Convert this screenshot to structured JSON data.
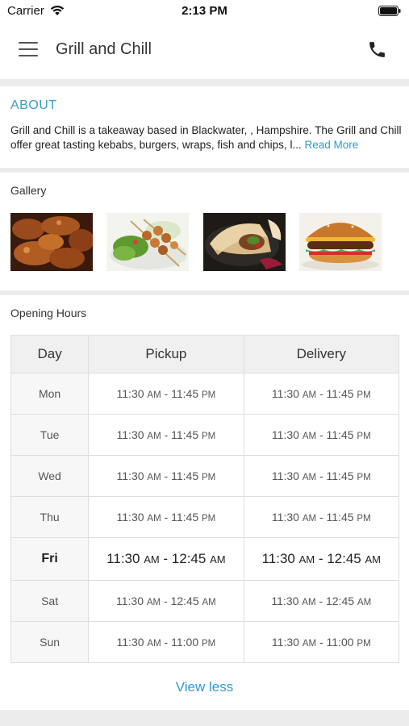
{
  "status_bar": {
    "carrier": "Carrier",
    "time": "2:13 PM"
  },
  "header": {
    "title": "Grill and Chill"
  },
  "about": {
    "heading": "ABOUT",
    "text": "Grill and Chill is a takeaway based in Blackwater,  , Hampshire. The Grill and Chill offer great tasting kebabs, burgers, wraps, fish and chips, l...",
    "read_more": "Read More"
  },
  "gallery": {
    "label": "Gallery",
    "images": [
      "chicken-wings-photo",
      "kebab-skewers-photo",
      "wrap-photo",
      "burger-photo"
    ]
  },
  "opening_hours": {
    "label": "Opening Hours",
    "columns": [
      "Day",
      "Pickup",
      "Delivery"
    ],
    "rows": [
      {
        "day": "Mon",
        "pickup_open": "11:30",
        "pickup_open_suffix": "AM",
        "pickup_close": "11:45",
        "pickup_close_suffix": "PM",
        "delivery_open": "11:30",
        "delivery_open_suffix": "AM",
        "delivery_close": "11:45",
        "delivery_close_suffix": "PM"
      },
      {
        "day": "Tue",
        "pickup_open": "11:30",
        "pickup_open_suffix": "AM",
        "pickup_close": "11:45",
        "pickup_close_suffix": "PM",
        "delivery_open": "11:30",
        "delivery_open_suffix": "AM",
        "delivery_close": "11:45",
        "delivery_close_suffix": "PM"
      },
      {
        "day": "Wed",
        "pickup_open": "11:30",
        "pickup_open_suffix": "AM",
        "pickup_close": "11:45",
        "pickup_close_suffix": "PM",
        "delivery_open": "11:30",
        "delivery_open_suffix": "AM",
        "delivery_close": "11:45",
        "delivery_close_suffix": "PM"
      },
      {
        "day": "Thu",
        "pickup_open": "11:30",
        "pickup_open_suffix": "AM",
        "pickup_close": "11:45",
        "pickup_close_suffix": "PM",
        "delivery_open": "11:30",
        "delivery_open_suffix": "AM",
        "delivery_close": "11:45",
        "delivery_close_suffix": "PM"
      },
      {
        "day": "Fri",
        "pickup_open": "11:30",
        "pickup_open_suffix": "AM",
        "pickup_close": "12:45",
        "pickup_close_suffix": "AM",
        "delivery_open": "11:30",
        "delivery_open_suffix": "AM",
        "delivery_close": "12:45",
        "delivery_close_suffix": "AM"
      },
      {
        "day": "Sat",
        "pickup_open": "11:30",
        "pickup_open_suffix": "AM",
        "pickup_close": "12:45",
        "pickup_close_suffix": "AM",
        "delivery_open": "11:30",
        "delivery_open_suffix": "AM",
        "delivery_close": "12:45",
        "delivery_close_suffix": "AM"
      },
      {
        "day": "Sun",
        "pickup_open": "11:30",
        "pickup_open_suffix": "AM",
        "pickup_close": "11:00",
        "pickup_close_suffix": "PM",
        "delivery_open": "11:30",
        "delivery_open_suffix": "AM",
        "delivery_close": "11:00",
        "delivery_close_suffix": "PM"
      }
    ],
    "highlight_day": "Fri",
    "view_less": "View less"
  },
  "colors": {
    "accent": "#2e9ad0",
    "about_heading": "#3aa0c2",
    "page_background": "#ececec"
  },
  "icons": [
    "wifi-icon",
    "battery-icon",
    "menu-icon",
    "phone-icon"
  ]
}
